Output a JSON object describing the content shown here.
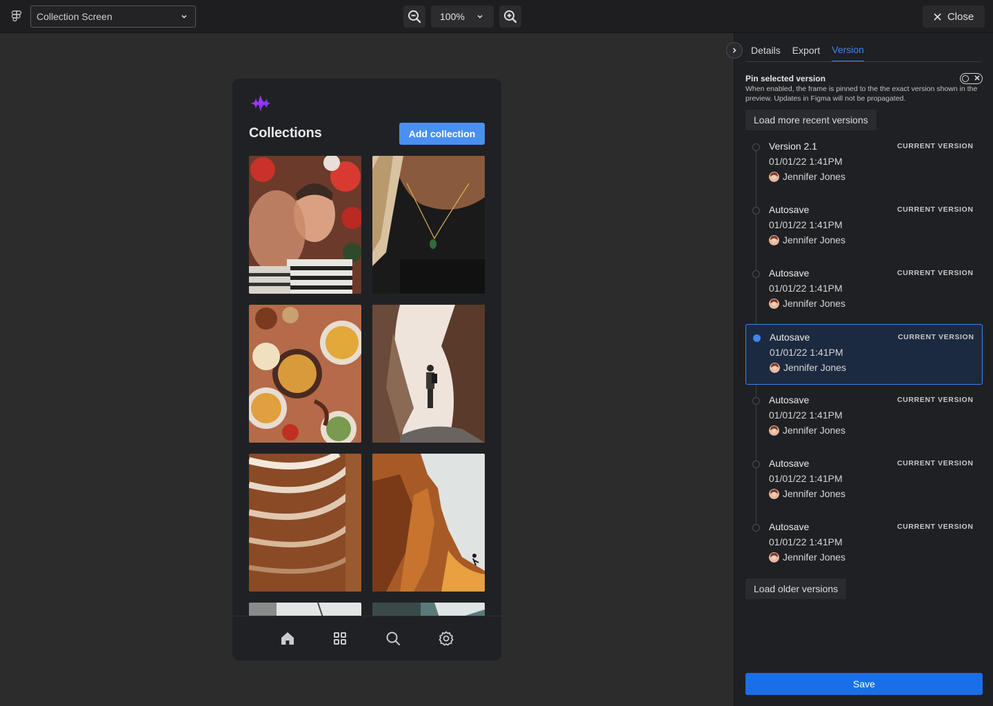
{
  "topbar": {
    "screen_select": "Collection Screen",
    "zoom_level": "100%",
    "close_label": "Close"
  },
  "app": {
    "title": "Collections",
    "add_button": "Add collection",
    "photos": [
      "portrait-man-flowers",
      "necklace-closeup",
      "food-table",
      "canyon-hiker",
      "architecture-curves",
      "cliff-climber",
      "partial-bw-building",
      "partial-teal-building"
    ],
    "tabs": [
      "home-icon",
      "grid-icon",
      "search-icon",
      "settings-icon"
    ]
  },
  "panel": {
    "tabs": [
      {
        "label": "Details",
        "active": false
      },
      {
        "label": "Export",
        "active": false
      },
      {
        "label": "Version",
        "active": true
      }
    ],
    "pin": {
      "title": "Pin selected version",
      "description": "When enabled, the frame is pinned to the the exact version shown in the preview. Updates in Figma will not be propagated.",
      "enabled": false
    },
    "load_recent": "Load more recent versions",
    "versions": [
      {
        "name": "Version 2.1",
        "date": "01/01/22 1:41PM",
        "author": "Jennifer Jones",
        "badge": "CURRENT VERSION",
        "selected": false
      },
      {
        "name": "Autosave",
        "date": "01/01/22 1:41PM",
        "author": "Jennifer Jones",
        "badge": "CURRENT VERSION",
        "selected": false
      },
      {
        "name": "Autosave",
        "date": "01/01/22 1:41PM",
        "author": "Jennifer Jones",
        "badge": "CURRENT VERSION",
        "selected": false
      },
      {
        "name": "Autosave",
        "date": "01/01/22 1:41PM",
        "author": "Jennifer Jones",
        "badge": "CURRENT VERSION",
        "selected": true
      },
      {
        "name": "Autosave",
        "date": "01/01/22 1:41PM",
        "author": "Jennifer Jones",
        "badge": "CURRENT VERSION",
        "selected": false
      },
      {
        "name": "Autosave",
        "date": "01/01/22 1:41PM",
        "author": "Jennifer Jones",
        "badge": "CURRENT VERSION",
        "selected": false
      },
      {
        "name": "Autosave",
        "date": "01/01/22 1:41PM",
        "author": "Jennifer Jones",
        "badge": "CURRENT VERSION",
        "selected": false
      }
    ],
    "load_older": "Load older versions",
    "save_label": "Save"
  },
  "colors": {
    "accent": "#3b86f0",
    "save": "#1a6fe8",
    "add_button": "#4a90f0",
    "background": "#2c2c2c",
    "panel": "#1f2023"
  }
}
